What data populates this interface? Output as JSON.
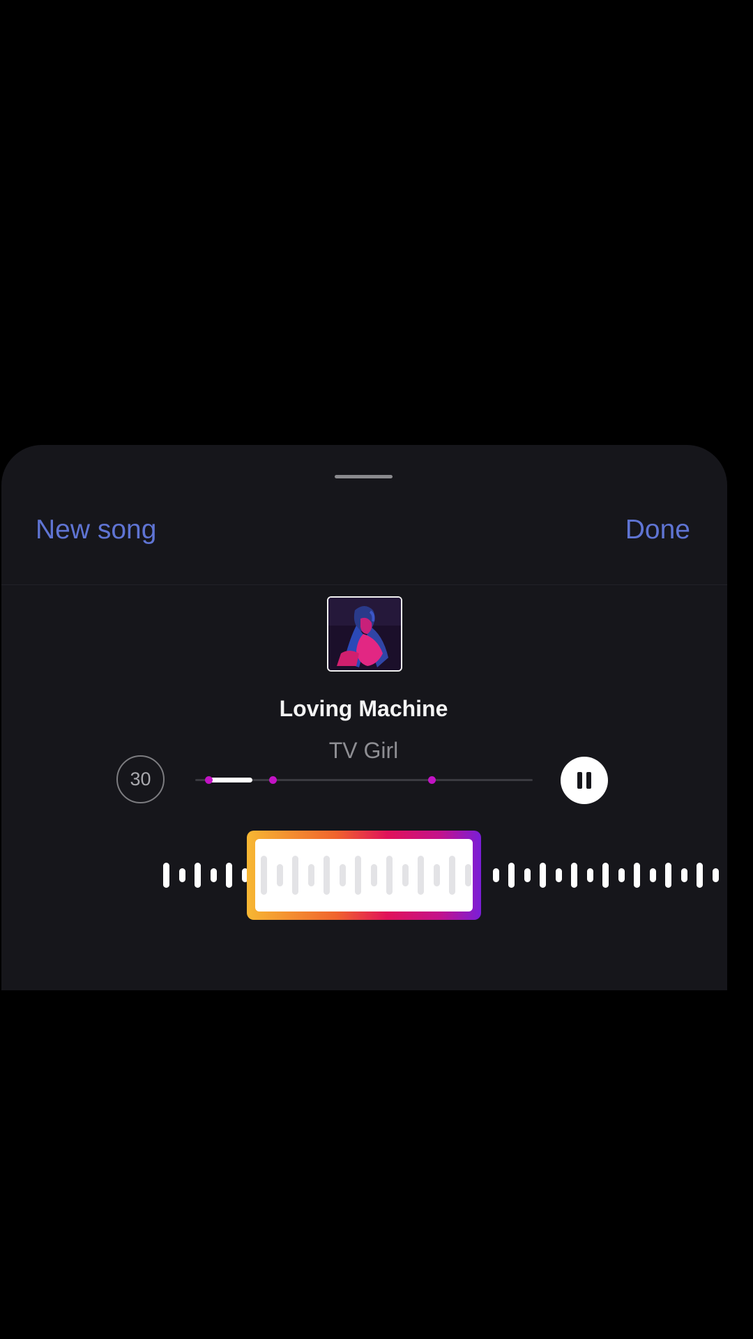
{
  "header": {
    "new_song_label": "New song",
    "done_label": "Done"
  },
  "track": {
    "title": "Loving Machine",
    "artist": "TV Girl",
    "album_art_icon": "album-cover"
  },
  "controls": {
    "duration_label": "30",
    "play_state": "playing",
    "pause_icon": "pause-icon"
  },
  "progress": {
    "played_fraction": 0.13,
    "marker_fractions": [
      0.04,
      0.23,
      0.7
    ]
  },
  "colors": {
    "accent_blue": "#5f74d3",
    "marker_magenta": "#c213c4",
    "sheet_background": "#16161b"
  }
}
